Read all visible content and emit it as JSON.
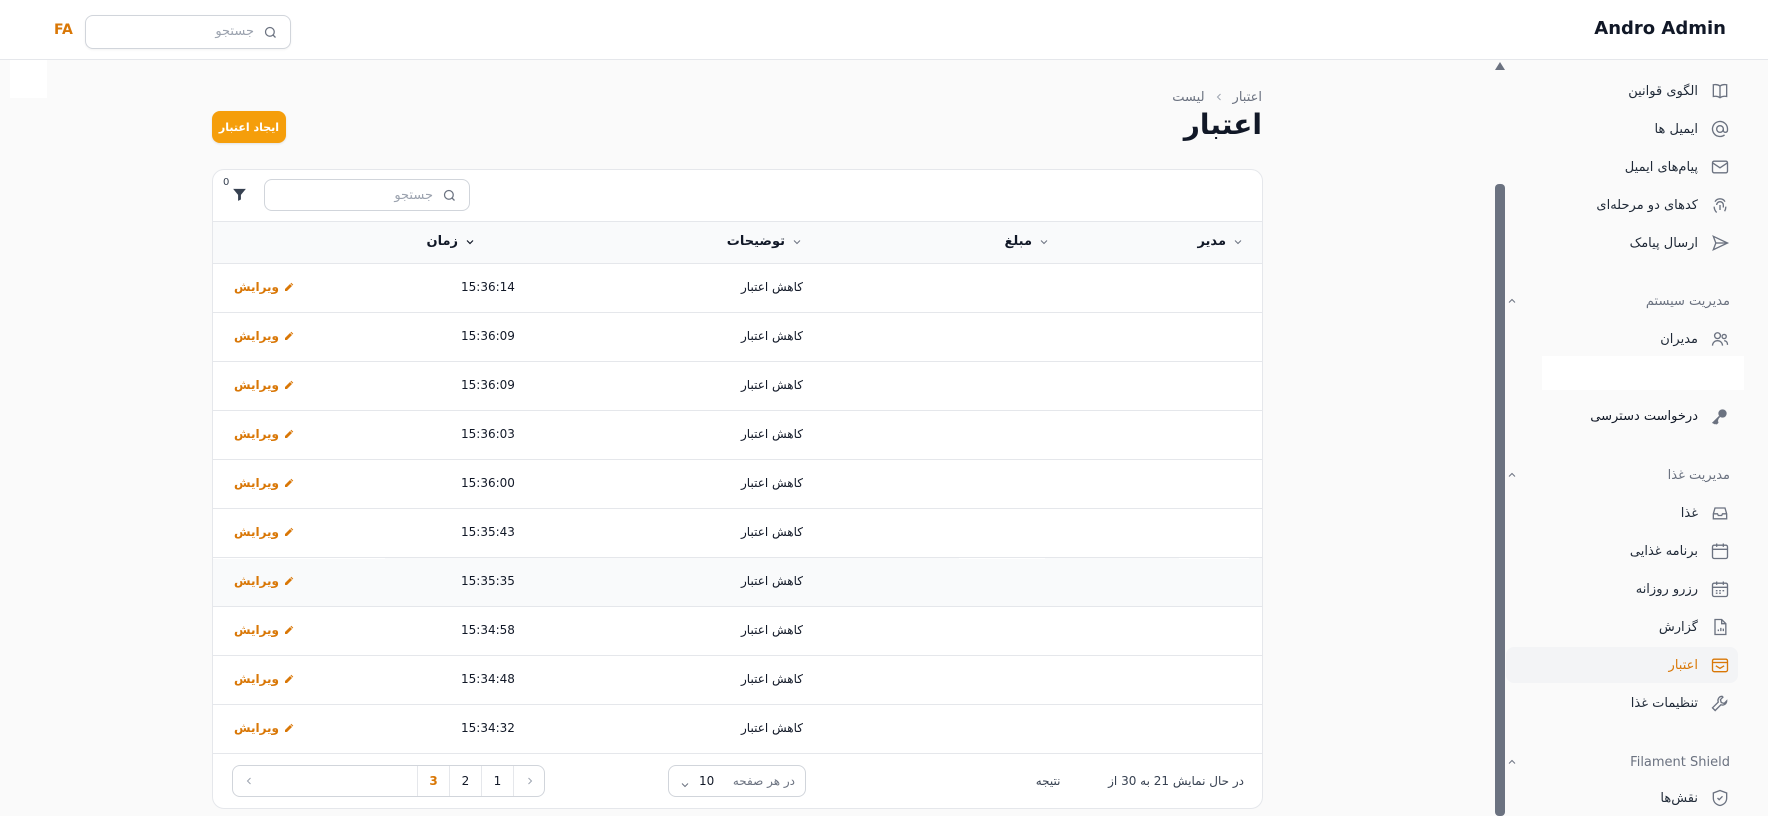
{
  "header": {
    "brand": "Andro Admin",
    "lang": "FA",
    "search_placeholder": "جستجو"
  },
  "sidebar": {
    "items_top": [
      {
        "label": "الگوی قوانین",
        "icon": "book-icon"
      },
      {
        "label": "ایمیل ها",
        "icon": "at-icon"
      },
      {
        "label": "پیام‌های ایمیل",
        "icon": "envelope-icon"
      },
      {
        "label": "کدهای دو مرحله‌ای",
        "icon": "fingerprint-icon"
      },
      {
        "label": "ارسال پیامک",
        "icon": "send-icon"
      }
    ],
    "group_system": "مدیریت سیستم",
    "item_admins": "مدیران",
    "item_access": "درخواست دسترسی",
    "group_food": "مدیریت غذا",
    "items_food": [
      {
        "label": "غذا",
        "icon": "inbox-icon"
      },
      {
        "label": "برنامه غذایی",
        "icon": "calendar-icon"
      },
      {
        "label": "رزرو روزانه",
        "icon": "calendar-days-icon"
      },
      {
        "label": "گزارش",
        "icon": "document-chart-icon"
      },
      {
        "label": "اعتبار",
        "icon": "wallet-icon",
        "active": true
      },
      {
        "label": "تنظیمات غذا",
        "icon": "wrench-icon"
      }
    ],
    "group_shield": "Filament Shield",
    "item_roles": "نقش‌ها"
  },
  "main": {
    "breadcrumb": [
      "اعتبار",
      "لیست"
    ],
    "title": "اعتبار",
    "create_label": "ایجاد اعتبار"
  },
  "table": {
    "search_placeholder": "جستجو",
    "filter_count": "0",
    "columns": {
      "manager": "مدیر",
      "amount": "مبلغ",
      "description": "توضیحات",
      "time": "زمان"
    },
    "edit_label": "ویرایش",
    "rows": [
      {
        "description": "کاهش اعتبار",
        "time": "15:36:14"
      },
      {
        "description": "کاهش اعتبار",
        "time": "15:36:09"
      },
      {
        "description": "کاهش اعتبار",
        "time": "15:36:09"
      },
      {
        "description": "کاهش اعتبار",
        "time": "15:36:03"
      },
      {
        "description": "کاهش اعتبار",
        "time": "15:36:00"
      },
      {
        "description": "کاهش اعتبار",
        "time": "15:35:43"
      },
      {
        "description": "کاهش اعتبار",
        "time": "15:35:35"
      },
      {
        "description": "کاهش اعتبار",
        "time": "15:34:58"
      },
      {
        "description": "کاهش اعتبار",
        "time": "15:34:48"
      },
      {
        "description": "کاهش اعتبار",
        "time": "15:34:32"
      }
    ],
    "footer": {
      "results_prefix": "در حال نمایش 21 به 30 از",
      "results_suffix": "نتیجه",
      "per_page_label": "در هر صفحه",
      "per_page_value": "10",
      "pages": [
        "1",
        "2",
        "3"
      ],
      "current_page": "3"
    }
  },
  "colors": {
    "accent": "#f59e0b",
    "accent_text": "#d97706"
  }
}
